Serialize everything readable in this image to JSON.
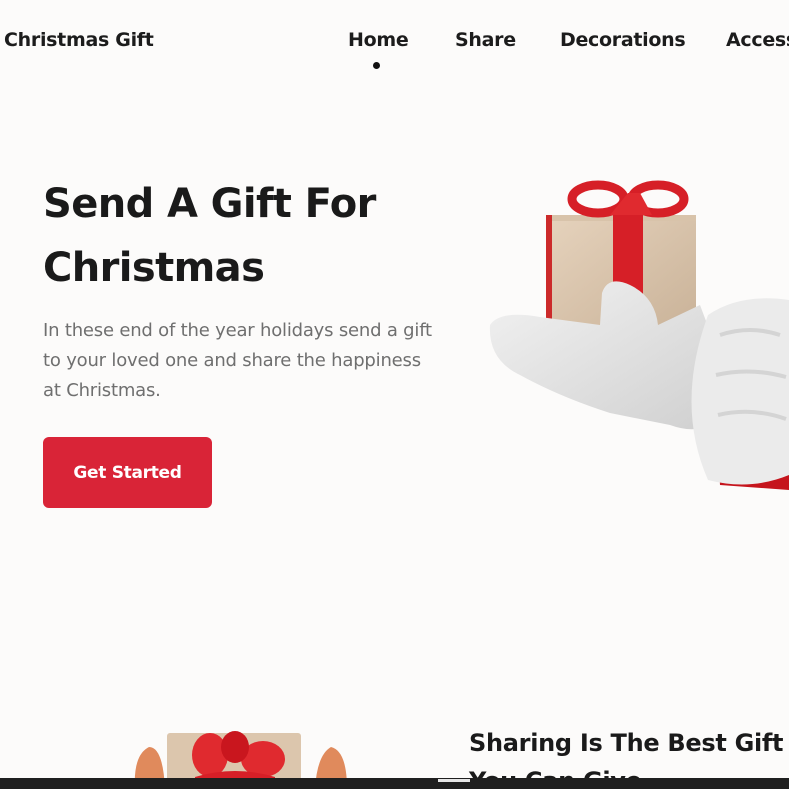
{
  "header": {
    "logo": "Christmas Gift",
    "nav": [
      "Home",
      "Share",
      "Decorations",
      "Access"
    ],
    "active_nav": "Home"
  },
  "hero": {
    "title_line1": "Send A Gift For",
    "title_line2": "Christmas",
    "description": "In these end of the year holidays send a gift to your loved one and share the happiness at Christmas.",
    "cta_label": "Get Started",
    "illustration": "gloved-hand-holding-gift-icon"
  },
  "section2": {
    "title": "Sharing Is The Best Gift You Can Give",
    "illustration": "hands-holding-gift-icon"
  },
  "colors": {
    "accent": "#d92437",
    "background": "#fcfbfa",
    "text": "#1c1c1c",
    "muted_text": "#6f6f6f"
  }
}
